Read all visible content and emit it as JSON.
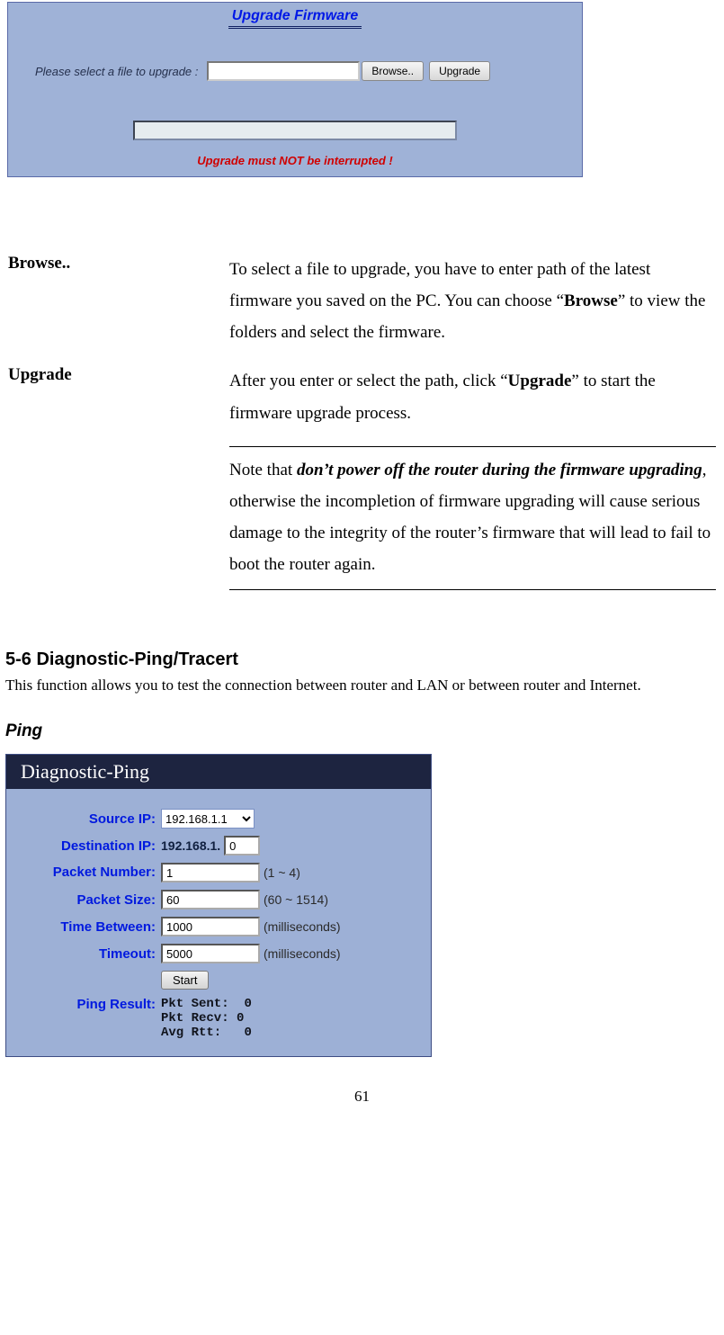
{
  "firmware_panel": {
    "title": "Upgrade Firmware",
    "select_label": "Please select a file to upgrade :",
    "file_value": "",
    "browse_label": "Browse..",
    "upgrade_label": "Upgrade",
    "warning": "Upgrade must NOT be interrupted !"
  },
  "descriptions": {
    "browse_term": "Browse..",
    "browse_desc_before": "To select a file to upgrade, you have to enter path of the latest firmware you saved on the PC. You can choose “",
    "browse_desc_bold": "Browse",
    "browse_desc_after": "” to view the folders and select the firmware.",
    "upgrade_term": "Upgrade",
    "upgrade_desc_before": "After you enter or select the path, click “",
    "upgrade_desc_bold": "Upgrade",
    "upgrade_desc_after": "” to start the firmware upgrade process.",
    "note_before": "Note that ",
    "note_bold": "don’t power off the router during the firmware upgrading",
    "note_after": ", otherwise the incompletion of firmware upgrading will cause serious damage to the integrity of the router’s firmware that will lead to fail to boot the router again."
  },
  "section": {
    "heading": "5-6 Diagnostic-Ping/Tracert",
    "body": "This function allows you to test the connection between router and LAN or between router and Internet.",
    "ping_heading": "Ping"
  },
  "ping_panel": {
    "title": "Diagnostic-Ping",
    "source_label": "Source IP:",
    "source_value": "192.168.1.1",
    "dest_label": "Destination IP:",
    "dest_prefix": "192.168.1.",
    "dest_value": "0",
    "pkt_num_label": "Packet Number:",
    "pkt_num_value": "1",
    "pkt_num_hint": "(1 ~ 4)",
    "pkt_size_label": "Packet Size:",
    "pkt_size_value": "60",
    "pkt_size_hint": "(60 ~ 1514)",
    "time_between_label": "Time Between:",
    "time_between_value": "1000",
    "time_between_hint": "(milliseconds)",
    "timeout_label": "Timeout:",
    "timeout_value": "5000",
    "timeout_hint": "(milliseconds)",
    "start_label": "Start",
    "result_label": "Ping Result:",
    "result_sent_label": "Pkt Sent:",
    "result_sent_value": "0",
    "result_recv_label": "Pkt Recv:",
    "result_recv_value": "0",
    "result_rtt_label": "Avg Rtt:",
    "result_rtt_value": "0"
  },
  "page_number": "61"
}
